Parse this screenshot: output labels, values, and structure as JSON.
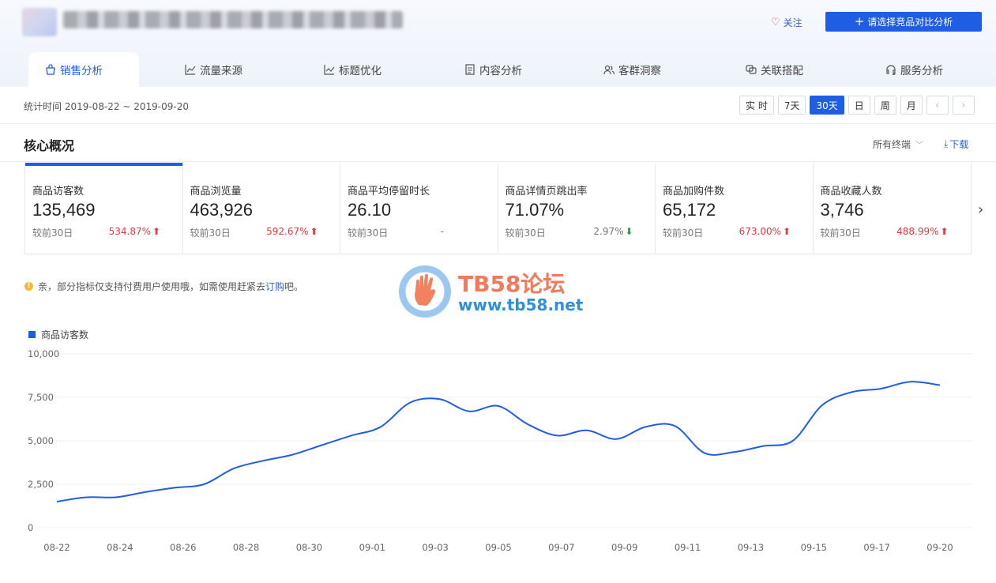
{
  "header": {
    "follow_label": "关注",
    "compare_label": "请选择竞品对比分析"
  },
  "tabs": [
    {
      "label": "销售分析",
      "icon": "bag-icon",
      "active": true
    },
    {
      "label": "流量来源",
      "icon": "line-chart-icon"
    },
    {
      "label": "标题优化",
      "icon": "trend-icon"
    },
    {
      "label": "内容分析",
      "icon": "document-icon"
    },
    {
      "label": "客群洞察",
      "icon": "users-icon"
    },
    {
      "label": "关联搭配",
      "icon": "link-icon"
    },
    {
      "label": "服务分析",
      "icon": "headset-icon"
    }
  ],
  "datebar": {
    "stat_time": "统计时间 2019-08-22 ~ 2019-09-20",
    "ranges": [
      "实 时",
      "7天",
      "30天",
      "日",
      "周",
      "月"
    ],
    "active_range": "30天"
  },
  "section": {
    "title": "核心概况",
    "terminal": "所有终端",
    "download": "下载"
  },
  "metrics": [
    {
      "label": "商品访客数",
      "value": "135,469",
      "compare_label": "较前30日",
      "change": "534.87%",
      "direction": "up"
    },
    {
      "label": "商品浏览量",
      "value": "463,926",
      "compare_label": "较前30日",
      "change": "592.67%",
      "direction": "up"
    },
    {
      "label": "商品平均停留时长",
      "value": "26.10",
      "compare_label": "较前30日",
      "change": "-",
      "direction": "none"
    },
    {
      "label": "商品详情页跳出率",
      "value": "71.07%",
      "compare_label": "较前30日",
      "change": "2.97%",
      "direction": "down"
    },
    {
      "label": "商品加购件数",
      "value": "65,172",
      "compare_label": "较前30日",
      "change": "673.00%",
      "direction": "up"
    },
    {
      "label": "商品收藏人数",
      "value": "3,746",
      "compare_label": "较前30日",
      "change": "488.99%",
      "direction": "up"
    }
  ],
  "notice": {
    "text": "亲，部分指标仅支持付费用户使用哦，如需使用赶紧去",
    "link": "订购",
    "suffix": "吧。"
  },
  "watermark": {
    "title": "TB58论坛",
    "url": "www.tb58.net"
  },
  "colors": {
    "accent": "#1f5ee4",
    "up": "#e4393c",
    "down": "#13a54a"
  },
  "chart_data": {
    "type": "line",
    "series": [
      {
        "name": "商品访客数",
        "values": [
          1500,
          1750,
          1750,
          2050,
          2300,
          2500,
          3400,
          3850,
          4200,
          4750,
          5300,
          5800,
          7200,
          7400,
          6700,
          7000,
          5950,
          5300,
          5600,
          5100,
          5800,
          5850,
          4300,
          4350,
          4700,
          5000,
          7050,
          7800,
          8000,
          8400,
          8200
        ]
      }
    ],
    "x": [
      "08-22",
      "08-23",
      "08-24",
      "08-25",
      "08-26",
      "08-27",
      "08-28",
      "08-29",
      "08-30",
      "08-31",
      "09-01",
      "09-02",
      "09-03",
      "09-04",
      "09-05",
      "09-06",
      "09-07",
      "09-08",
      "09-09",
      "09-10",
      "09-11",
      "09-12",
      "09-13",
      "09-14",
      "09-15",
      "09-16",
      "09-16b",
      "09-17",
      "09-18",
      "09-19",
      "09-20"
    ],
    "xticks": [
      "08-22",
      "08-24",
      "08-26",
      "08-28",
      "08-30",
      "09-01",
      "09-03",
      "09-05",
      "09-07",
      "09-09",
      "09-11",
      "09-13",
      "09-15",
      "09-17",
      "09-20"
    ],
    "yticks": [
      "10,000",
      "7,500",
      "5,000",
      "2,500",
      "0"
    ],
    "ylim": [
      0,
      10000
    ],
    "grid": true,
    "legend": "top-left"
  }
}
